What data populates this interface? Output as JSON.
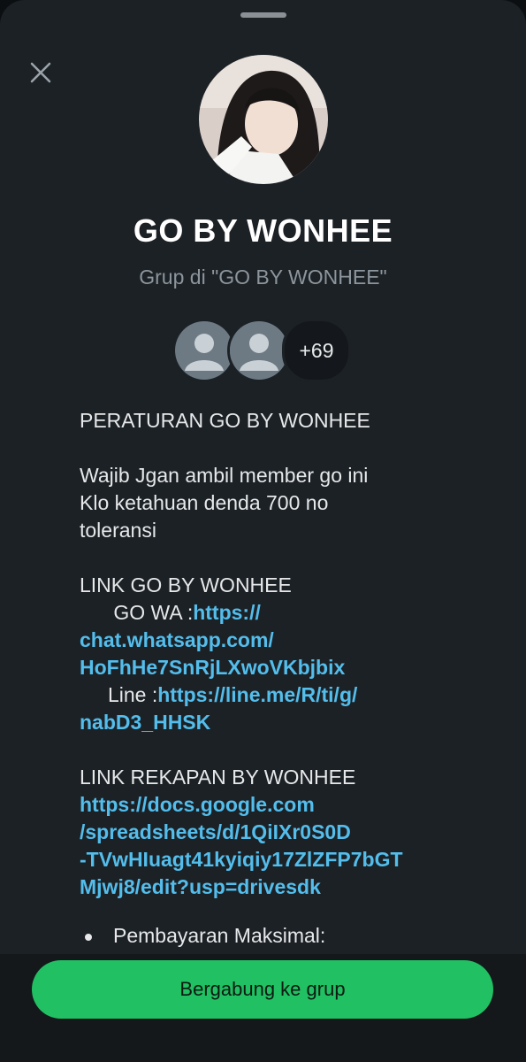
{
  "group": {
    "name": "GO BY WONHEE",
    "subtitle": "Grup di \"GO BY WONHEE\"",
    "extra_members": "+69"
  },
  "description": {
    "rules_title": "PERATURAN GO BY WONHEE",
    "rule_line1": "Wajib Jgan ambil member go ini",
    "rule_line2": "Klo ketahuan denda 700 no",
    "rule_line3": "toleransi",
    "link_title": "LINK GO BY WONHEE",
    "wa_label": "      GO WA :",
    "wa_link_1": "https://",
    "wa_link_2": "chat.whatsapp.com/",
    "wa_link_3": "HoFhHe7SnRjLXwoVKbjbix",
    "line_label": "     Line :",
    "line_link_1": "https://line.me/R/ti/g/",
    "line_link_2": "nabD3_HHSK",
    "recap_title": "LINK REKAPAN BY WONHEE",
    "recap_link_1": "https://docs.google.com",
    "recap_link_2": "/spreadsheets/d/1QiIXr0S0D",
    "recap_link_3": "-TVwHIuagt41kyiqiy17ZlZFP7bGT",
    "recap_link_4": "Mjwj8/edit?usp=drivesdk",
    "bullet_1": "Pembayaran Maksimal:"
  },
  "actions": {
    "join_label": "Bergabung ke grup"
  },
  "colors": {
    "accent": "#21c063",
    "link": "#53bdeb",
    "background": "#1c2126"
  },
  "icons": [
    "close-icon",
    "default-avatar-icon"
  ]
}
